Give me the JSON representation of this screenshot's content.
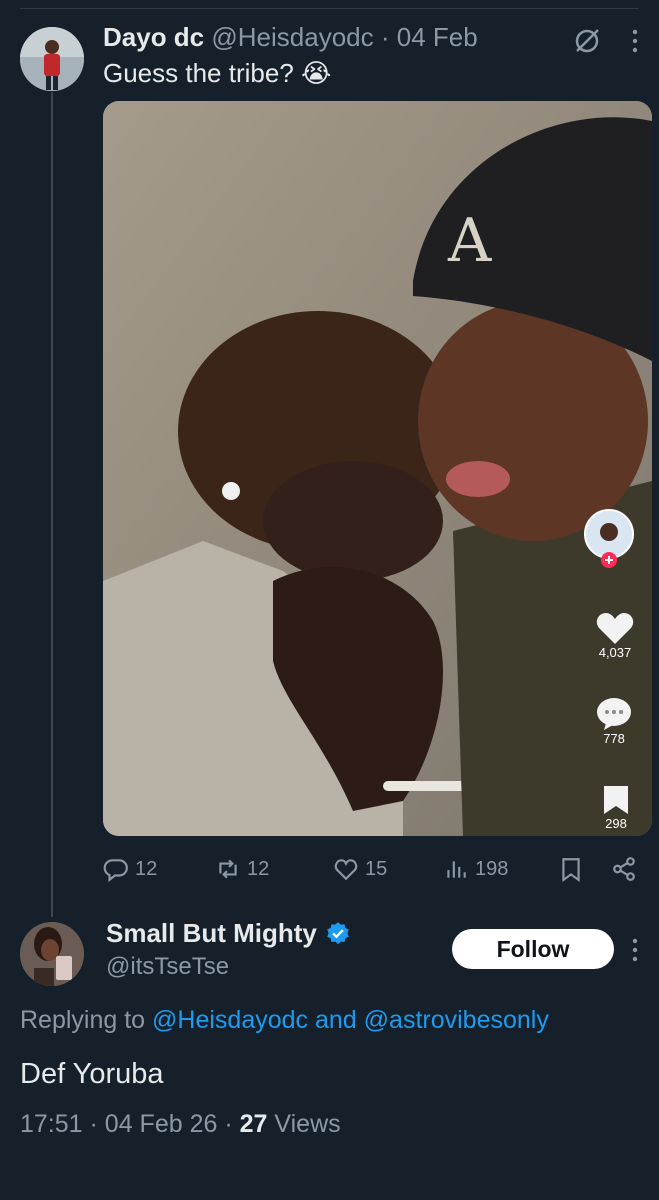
{
  "tweet": {
    "author_name": "Dayo dc",
    "author_handle": "@Heisdayodc",
    "separator": "·",
    "date": "04 Feb",
    "text": "Guess the tribe? 😭",
    "media": {
      "tiktok_likes": "4,037",
      "tiktok_comments": "778",
      "tiktok_saves": "298",
      "follow_plus": "+"
    },
    "stats": {
      "replies": "12",
      "reposts": "12",
      "likes": "15",
      "views": "198"
    }
  },
  "reply": {
    "author_name": "Small But Mighty",
    "author_handle": "@itsTseTse",
    "verified": true,
    "follow_label": "Follow",
    "replying_prefix": "Replying to",
    "replying_user1": "@Heisdayodc",
    "replying_and": "and",
    "replying_user2": "@astrovibesonly",
    "text": "Def Yoruba",
    "time": "17:51",
    "date": "04 Feb 26",
    "views_count": "27",
    "views_label": "Views"
  },
  "colors": {
    "background": "#15202b",
    "accent": "#1d9bf0",
    "muted": "#8b98a5",
    "text": "#e7e9ea"
  }
}
